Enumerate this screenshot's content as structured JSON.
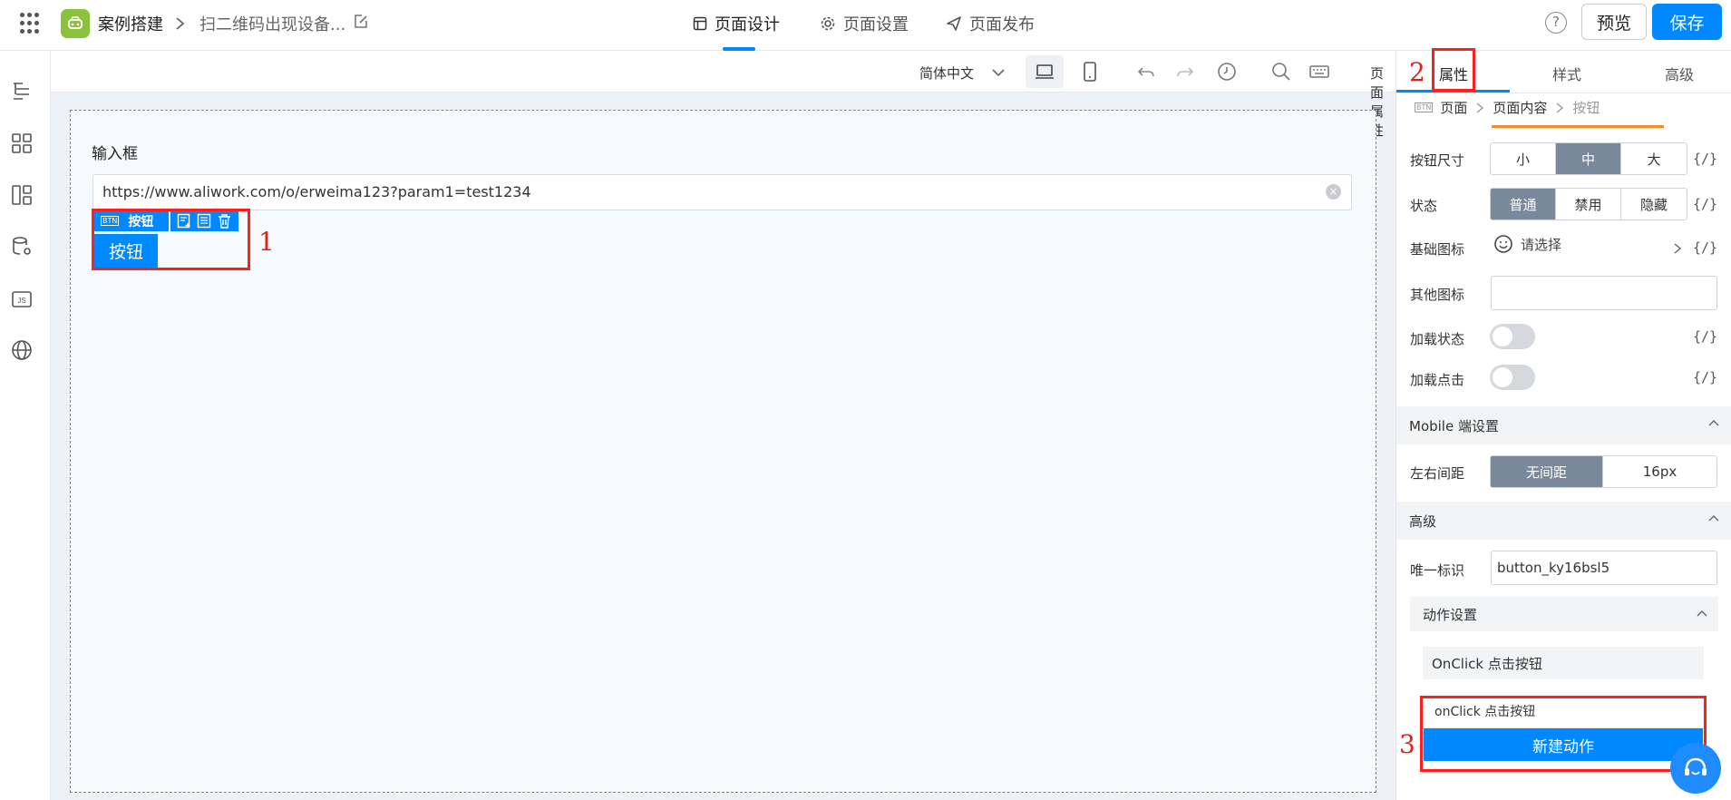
{
  "header": {
    "app_name": "案例搭建",
    "page_name": "扫二维码出现设备...",
    "tabs": [
      {
        "label": "页面设计"
      },
      {
        "label": "页面设置"
      },
      {
        "label": "页面发布"
      }
    ],
    "help_label": "?",
    "preview_label": "预览",
    "save_label": "保存"
  },
  "toolbar": {
    "language": "简体中文",
    "page_attr_label": "页面属性"
  },
  "canvas": {
    "input_label": "输入框",
    "input_value": "https://www.aliwork.com/o/erweima123?param1=test1234",
    "selection_badge_icon": "BTN",
    "selection_badge_label": "按钮",
    "button_label": "按钮"
  },
  "annotations": {
    "one": "1",
    "two": "2",
    "three": "3"
  },
  "right_panel": {
    "tabs": [
      "属性",
      "样式",
      "高级"
    ],
    "breadcrumb": {
      "icon": "BTN",
      "page": "页面",
      "content": "页面内容",
      "current": "按钮"
    },
    "size": {
      "label": "按钮尺寸",
      "options": [
        "小",
        "中",
        "大"
      ],
      "selected": "中"
    },
    "status": {
      "label": "状态",
      "options": [
        "普通",
        "禁用",
        "隐藏"
      ],
      "selected": "普通"
    },
    "base_icon": {
      "label": "基础图标",
      "placeholder": "请选择"
    },
    "other_icon": {
      "label": "其他图标",
      "value": ""
    },
    "loading_state": {
      "label": "加载状态",
      "on": false
    },
    "loading_click": {
      "label": "加载点击",
      "on": false
    },
    "code_label": "{/}",
    "mobile_section": "Mobile 端设置",
    "margin": {
      "label": "左右间距",
      "options": [
        "无间距",
        "16px"
      ],
      "selected": "无间距"
    },
    "advanced_section": "高级",
    "unique_id": {
      "label": "唯一标识",
      "value": "button_ky16bsl5"
    },
    "action_section": "动作设置",
    "onclick_row": "OnClick 点击按钮",
    "dropdown_item": "onClick 点击按钮",
    "new_action": "新建动作"
  },
  "colors": {
    "accent": "#0089ff",
    "annotation_red": "#e51c1c",
    "segment_on": "#7a889c",
    "app_logo": "#8ac23b"
  }
}
